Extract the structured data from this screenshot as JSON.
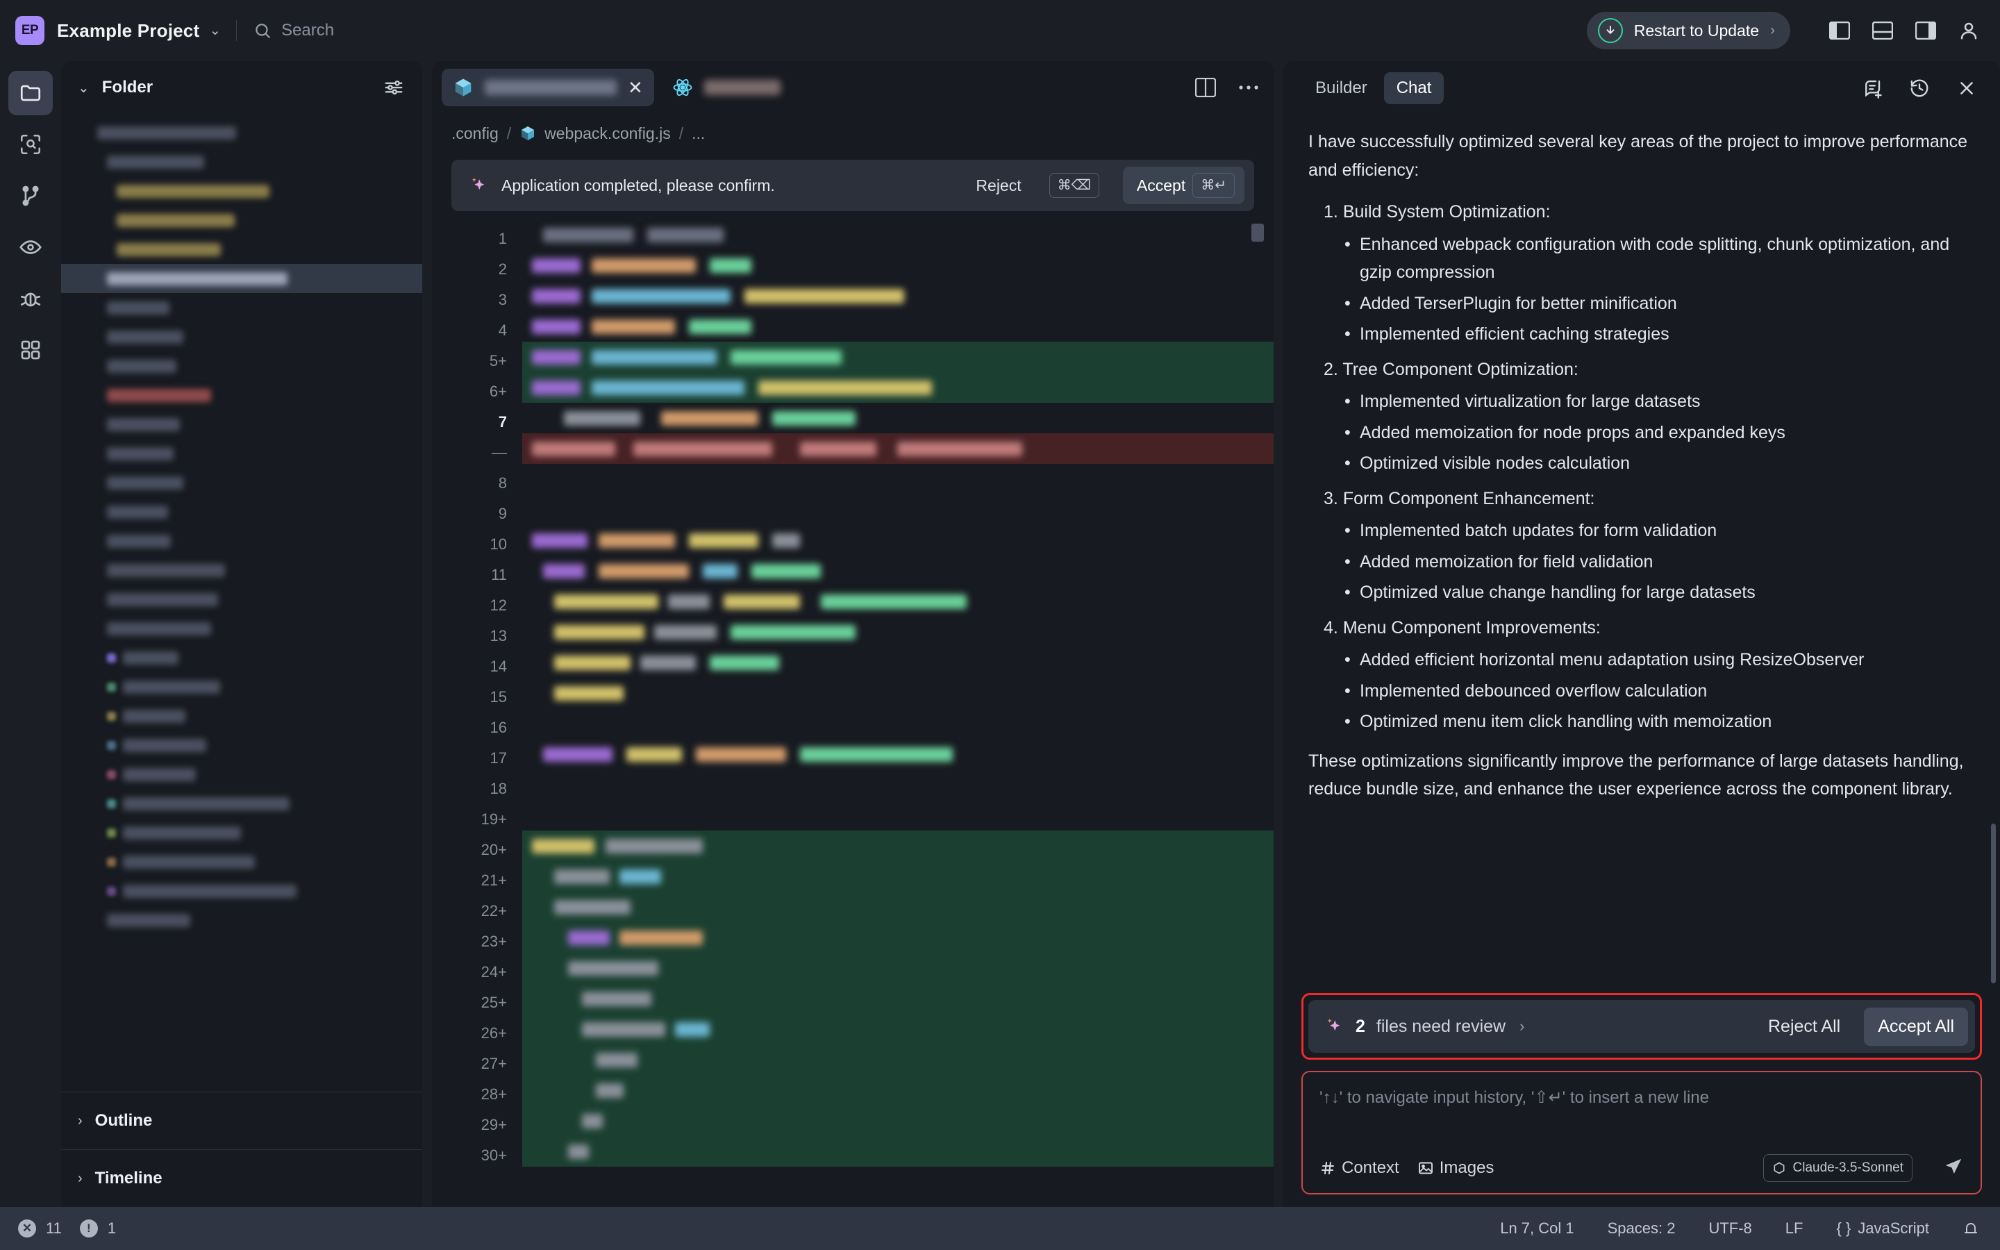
{
  "titlebar": {
    "project_initials": "EP",
    "project_name": "Example Project",
    "project_chevron": "chevron-down",
    "search_placeholder": "Search",
    "update_label": "Restart to Update",
    "update_accent": "#34d399"
  },
  "activitybar": {
    "items": [
      {
        "name": "explorer",
        "icon": "folder-icon",
        "active": true
      },
      {
        "name": "search",
        "icon": "search-scope-icon",
        "active": false
      },
      {
        "name": "source-control",
        "icon": "branch-icon",
        "active": false
      },
      {
        "name": "preview",
        "icon": "eye-icon",
        "active": false
      },
      {
        "name": "run-and-debug",
        "icon": "bug-icon",
        "active": false
      },
      {
        "name": "extensions",
        "icon": "grid-icon",
        "active": false
      }
    ]
  },
  "explorer": {
    "title": "Folder",
    "filter_icon": "filter-icon",
    "sections": [
      {
        "label": "Outline"
      },
      {
        "label": "Timeline"
      }
    ]
  },
  "editor": {
    "tabs": [
      {
        "icon": "webpack-icon",
        "redacted": true,
        "active": true,
        "close_icon": "close-icon"
      },
      {
        "icon": "react-icon",
        "redacted": true,
        "active": false
      }
    ],
    "split_icon": "split-editor-icon",
    "more_icon": "more-horizontal-icon",
    "breadcrumb": [
      ".config",
      "webpack.config.js",
      "..."
    ],
    "breadcrumb_file_icon": "webpack-icon",
    "notice": {
      "sparkle_icon": "sparkle-icon",
      "text": "Application completed, please confirm.",
      "reject_label": "Reject",
      "reject_kbd": "⌘⌫",
      "accept_label": "Accept",
      "accept_kbd": "⌘↵"
    },
    "gutter_lines": [
      {
        "n": "1",
        "marker": "",
        "current": false
      },
      {
        "n": "2",
        "marker": "",
        "current": false
      },
      {
        "n": "3",
        "marker": "",
        "current": false
      },
      {
        "n": "4",
        "marker": "",
        "current": false
      },
      {
        "n": "5",
        "marker": "+",
        "current": false
      },
      {
        "n": "6",
        "marker": "+",
        "current": false
      },
      {
        "n": "7",
        "marker": "",
        "current": true
      },
      {
        "n": "",
        "marker": "—",
        "current": false
      },
      {
        "n": "8",
        "marker": "",
        "current": false
      },
      {
        "n": "9",
        "marker": "",
        "current": false
      },
      {
        "n": "10",
        "marker": "",
        "current": false
      },
      {
        "n": "11",
        "marker": "",
        "current": false
      },
      {
        "n": "12",
        "marker": "",
        "current": false
      },
      {
        "n": "13",
        "marker": "",
        "current": false
      },
      {
        "n": "14",
        "marker": "",
        "current": false
      },
      {
        "n": "15",
        "marker": "",
        "current": false
      },
      {
        "n": "16",
        "marker": "",
        "current": false
      },
      {
        "n": "17",
        "marker": "",
        "current": false
      },
      {
        "n": "18",
        "marker": "",
        "current": false
      },
      {
        "n": "19",
        "marker": "+",
        "current": false
      },
      {
        "n": "20",
        "marker": "+",
        "current": false
      },
      {
        "n": "21",
        "marker": "+",
        "current": false
      },
      {
        "n": "22",
        "marker": "+",
        "current": false
      },
      {
        "n": "23",
        "marker": "+",
        "current": false
      },
      {
        "n": "24",
        "marker": "+",
        "current": false
      },
      {
        "n": "25",
        "marker": "+",
        "current": false
      },
      {
        "n": "26",
        "marker": "+",
        "current": false
      },
      {
        "n": "27",
        "marker": "+",
        "current": false
      },
      {
        "n": "28",
        "marker": "+",
        "current": false
      },
      {
        "n": "29",
        "marker": "+",
        "current": false
      },
      {
        "n": "30",
        "marker": "+",
        "current": false
      }
    ]
  },
  "chat": {
    "tabs": [
      {
        "label": "Builder",
        "active": false
      },
      {
        "label": "Chat",
        "active": true
      }
    ],
    "new_chat_icon": "new-chat-icon",
    "history_icon": "history-icon",
    "close_icon": "close-icon",
    "message": {
      "intro": "I have successfully optimized several key areas of the project to improve performance and efficiency:",
      "sections": [
        {
          "number": "1.",
          "heading": "Build System Optimization:",
          "bullets": [
            "Enhanced webpack configuration with code splitting, chunk optimization, and gzip compression",
            "Added TerserPlugin for better minification",
            "Implemented efficient caching strategies"
          ]
        },
        {
          "number": "2.",
          "heading": "Tree Component Optimization:",
          "bullets": [
            "Implemented virtualization for large datasets",
            "Added memoization for node props and expanded keys",
            "Optimized visible nodes calculation"
          ]
        },
        {
          "number": "3.",
          "heading": "Form Component Enhancement:",
          "bullets": [
            "Implemented batch updates for form validation",
            "Added memoization for field validation",
            "Optimized value change handling for large datasets"
          ]
        },
        {
          "number": "4.",
          "heading": "Menu Component Improvements:",
          "bullets": [
            "Added efficient horizontal menu adaptation using ResizeObserver",
            "Implemented debounced overflow calculation",
            "Optimized menu item click handling with memoization"
          ]
        }
      ],
      "outro": "These optimizations significantly improve the performance of large datasets handling, reduce bundle size, and enhance the user experience across the component library."
    },
    "review": {
      "sparkle_icon": "sparkle-icon",
      "count": "2",
      "label": "files need review",
      "chevron": "chevron-right",
      "reject_all_label": "Reject All",
      "accept_all_label": "Accept All",
      "highlight_color": "#ef2b2b"
    },
    "composer": {
      "placeholder": "'↑↓' to navigate input history, '⇧↵' to insert a new line",
      "context_label": "Context",
      "context_icon": "hash-icon",
      "images_label": "Images",
      "images_icon": "image-icon",
      "model": "Claude-3.5-Sonnet",
      "model_icon": "cube-icon",
      "send_icon": "send-icon"
    }
  },
  "statusbar": {
    "errors_icon": "error-icon",
    "errors": "11",
    "warnings_icon": "warning-icon",
    "warnings": "1",
    "cursor": "Ln 7, Col 1",
    "indent": "Spaces: 2",
    "encoding": "UTF-8",
    "eol": "LF",
    "language": "JavaScript",
    "language_icon": "braces-icon",
    "bell_icon": "bell-icon"
  }
}
